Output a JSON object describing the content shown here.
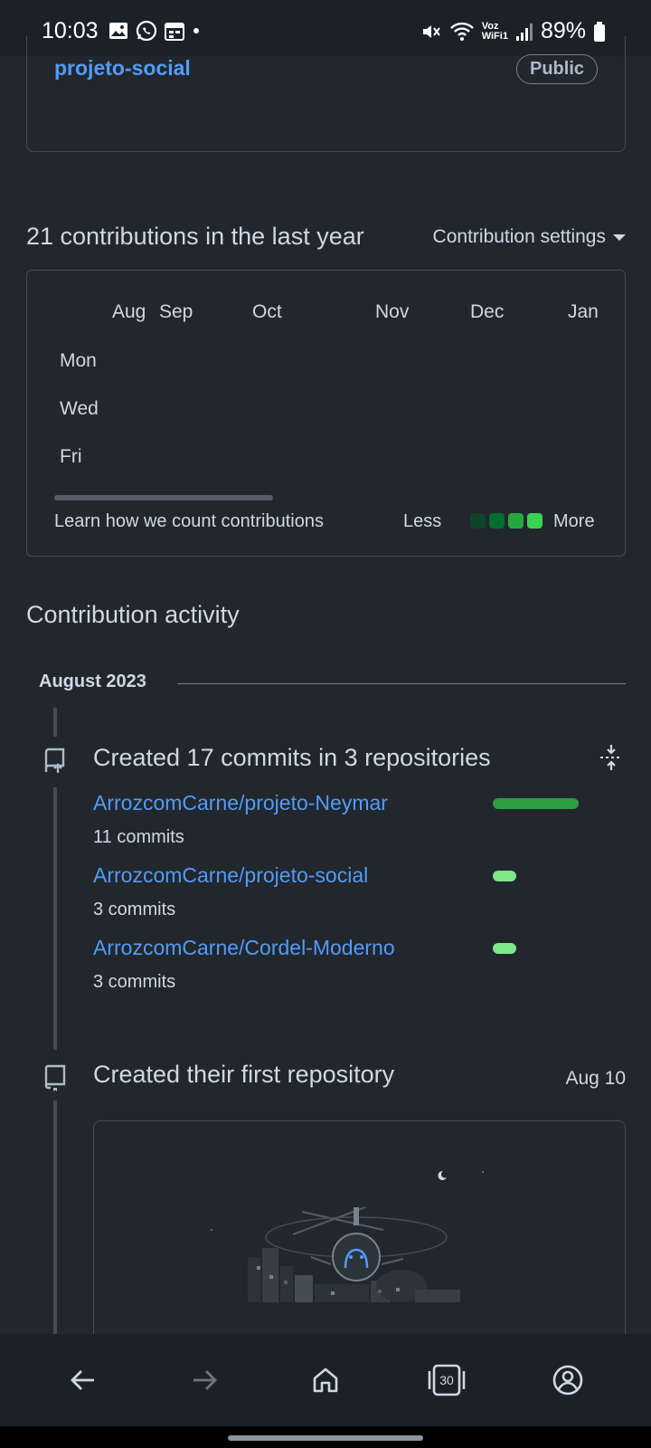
{
  "status_bar": {
    "time": "10:03",
    "battery": "89%",
    "network_label_top": "Voz",
    "network_label_bottom": "WiFi1"
  },
  "repo_card": {
    "name": "projeto-social",
    "visibility": "Public"
  },
  "contributions": {
    "heading": "21 contributions in the last year",
    "settings_label": "Contribution settings",
    "months": [
      "Aug",
      "Sep",
      "Oct",
      "Nov",
      "Dec",
      "Jan"
    ],
    "days": [
      "Mon",
      "Wed",
      "Fri"
    ],
    "learn_link": "Learn how we count contributions",
    "legend_less": "Less",
    "legend_more": "More",
    "legend_colors": [
      "#0e4429",
      "#006d32",
      "#26a641",
      "#39d353"
    ]
  },
  "activity": {
    "title": "Contribution activity",
    "month_label": "August 2023",
    "commits_event": {
      "title": "Created 17 commits in 3 repositories",
      "repos": [
        {
          "name": "ArrozcomCarne/projeto-Neymar",
          "commits": "11 commits",
          "share": 1.0,
          "color": "#2ea043"
        },
        {
          "name": "ArrozcomCarne/projeto-social",
          "commits": "3 commits",
          "share": 0.27,
          "color": "#7ee787"
        },
        {
          "name": "ArrozcomCarne/Cordel-Moderno",
          "commits": "3 commits",
          "share": 0.27,
          "color": "#7ee787"
        }
      ]
    },
    "first_repo_event": {
      "title": "Created their first repository",
      "date": "Aug 10"
    }
  },
  "bottom_nav": {
    "tab_count": "30"
  }
}
